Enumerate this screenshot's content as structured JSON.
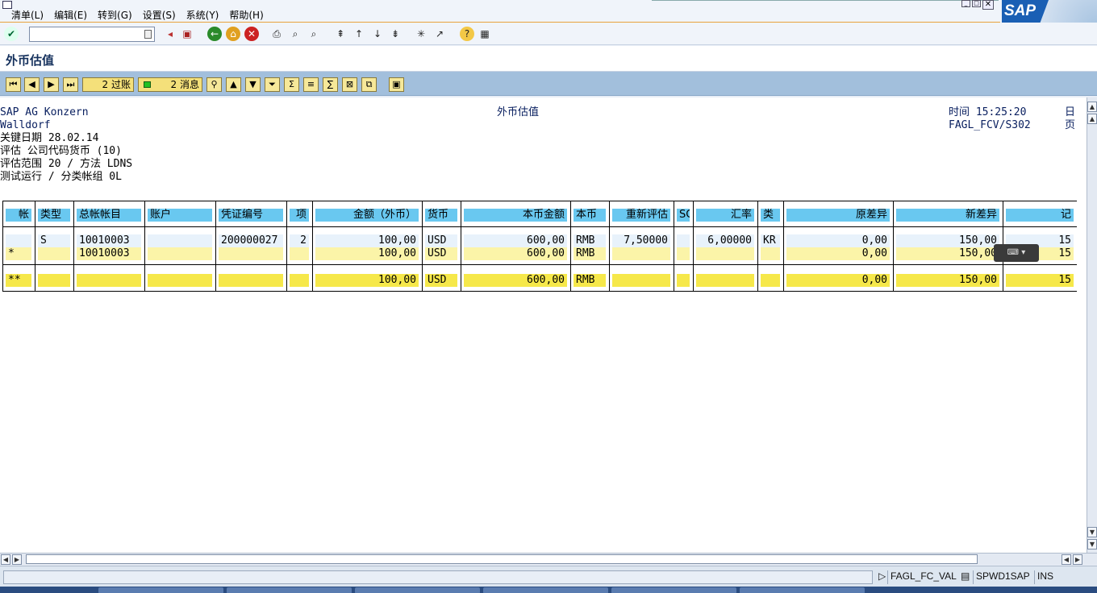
{
  "menu": {
    "items": [
      "清单(L)",
      "编辑(E)",
      "转到(G)",
      "设置(S)",
      "系统(Y)",
      "帮助(H)"
    ]
  },
  "logo_text": "SAP",
  "page_title": "外币估值",
  "app_toolbar": {
    "post_label": "2 过账",
    "messages_label": "2 消息"
  },
  "report_header": {
    "company": "SAP AG Konzern",
    "city": "Walldorf",
    "key_date": "关键日期 28.02.14",
    "valuation": "评估 公司代码货币 (10)",
    "valuation_area": "评估范围 20 / 方法 LDNS",
    "test_run": "测试运行 / 分类帐组 0L",
    "center_title": "外币估值",
    "time": "时间 15:25:20",
    "program": "FAGL_FCV/S302",
    "date_label": "日",
    "page_label": "页"
  },
  "table": {
    "columns": [
      "帐",
      "类型",
      "总帐帐目",
      "账户",
      "凭证编号",
      "项",
      "金额（外币）",
      "货币",
      "本币金额",
      "本币",
      "重新评估",
      "SG",
      "汇率",
      "类",
      "原差异",
      "新差异",
      "记"
    ],
    "rows": [
      [
        "",
        "S",
        "10010003",
        "",
        "200000027",
        "2",
        "100,00",
        "USD",
        "600,00",
        "RMB",
        "7,50000",
        "",
        "6,00000",
        "KR",
        "0,00",
        "150,00",
        "15"
      ],
      [
        "*",
        "",
        "10010003",
        "",
        "",
        "",
        "100,00",
        "USD",
        "600,00",
        "RMB",
        "",
        "",
        "",
        "",
        "0,00",
        "150,00",
        "15"
      ]
    ],
    "total": [
      "**",
      "",
      "",
      "",
      "",
      "",
      "100,00",
      "USD",
      "600,00",
      "RMB",
      "",
      "",
      "",
      "",
      "0,00",
      "150,00",
      "15"
    ]
  },
  "status_bar": {
    "transaction": "FAGL_FC_VAL",
    "server": "SPWD1SAP",
    "mode": "INS"
  },
  "colors": {
    "header_cell": "#69c8f0",
    "total_row": "#f6e84a",
    "app_toolbar": "#a2bfdc"
  }
}
